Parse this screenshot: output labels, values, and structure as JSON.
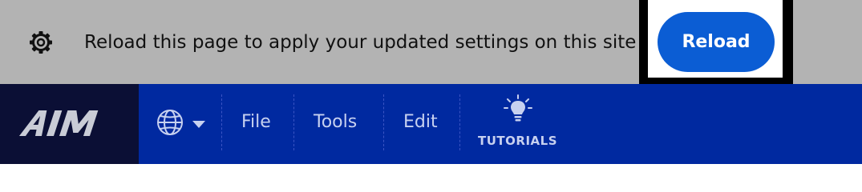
{
  "notification": {
    "icon": "gear-icon",
    "message": "Reload this page to apply your updated settings on this site",
    "reload_label": "Reload"
  },
  "toolbar": {
    "logo_text": "AIM",
    "language_icon": "globe-icon",
    "menu": {
      "file": "File",
      "tools": "Tools",
      "edit": "Edit"
    },
    "tutorials_label": "TUTORIALS",
    "tutorials_icon": "lightbulb-icon"
  },
  "colors": {
    "notification_bg": "#b3b3b3",
    "reload_button": "#0b5dd4",
    "toolbar_bg": "#0029a0",
    "logo_bg": "#0b0f35",
    "menu_text": "#c7d1f0"
  }
}
